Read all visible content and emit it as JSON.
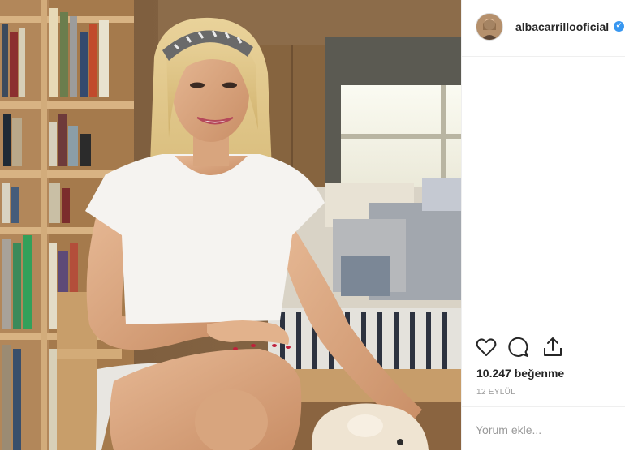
{
  "post": {
    "username": "albacarrillooficial",
    "verified_mark": "✔",
    "likes_text": "10.247 beğenme",
    "date_text": "12 EYLÜL",
    "comment_placeholder": "Yorum ekle..."
  },
  "icons": {
    "like": "heart-icon",
    "comment": "comment-icon",
    "share": "share-icon",
    "verified": "verified-badge-icon"
  },
  "colors": {
    "text": "#262626",
    "muted": "#999999",
    "verified": "#3897f0",
    "divider": "#efefef"
  }
}
